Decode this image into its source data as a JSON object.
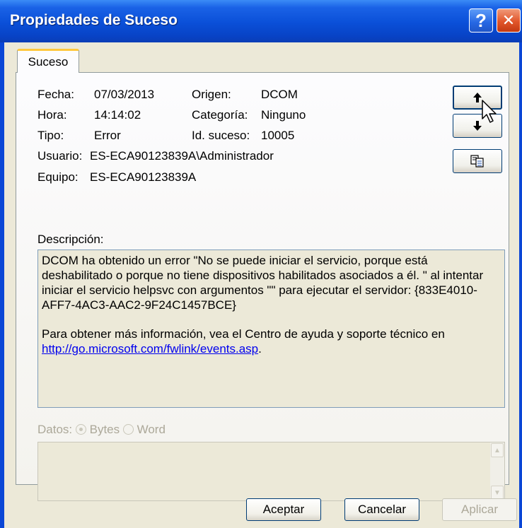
{
  "window": {
    "title": "Propiedades de Suceso",
    "help_label": "?",
    "close_label": "✕"
  },
  "tabs": [
    {
      "label": "Suceso"
    }
  ],
  "fields": {
    "fecha_label": "Fecha:",
    "fecha_value": "07/03/2013",
    "hora_label": "Hora:",
    "hora_value": "14:14:02",
    "tipo_label": "Tipo:",
    "tipo_value": "Error",
    "usuario_label": "Usuario:",
    "usuario_value": "ES-ECA90123839A\\Administrador",
    "equipo_label": "Equipo:",
    "equipo_value": "ES-ECA90123839A",
    "origen_label": "Origen:",
    "origen_value": "DCOM",
    "categoria_label": "Categoría:",
    "categoria_value": "Ninguno",
    "idsuceso_label": "Id. suceso:",
    "idsuceso_value": "10005"
  },
  "nav": {
    "up_icon": "arrow-up-icon",
    "down_icon": "arrow-down-icon",
    "copy_icon": "copy-icon"
  },
  "description": {
    "label": "Descripción:",
    "paragraph1": "DCOM ha obtenido un error \"No se puede iniciar el servicio, porque está deshabilitado o porque no tiene dispositivos habilitados asociados a él. \" al intentar iniciar el servicio helpsvc con argumentos \"\" para ejecutar el servidor: {833E4010-AFF7-4AC3-AAC2-9F24C1457BCE}",
    "paragraph2": "Para obtener más información, vea el Centro de ayuda y soporte técnico en",
    "link": "http://go.microsoft.com/fwlink/events.asp",
    "link_suffix": "."
  },
  "data": {
    "label": "Datos:",
    "option_bytes": "Bytes",
    "option_word": "Word",
    "selected": "Bytes"
  },
  "buttons": {
    "accept": "Aceptar",
    "cancel": "Cancelar",
    "apply": "Aplicar"
  },
  "colors": {
    "titlebar": "#0a4fd8",
    "client_bg": "#ece9d8",
    "tab_accent": "#ffc83c",
    "link": "#0000ee"
  }
}
